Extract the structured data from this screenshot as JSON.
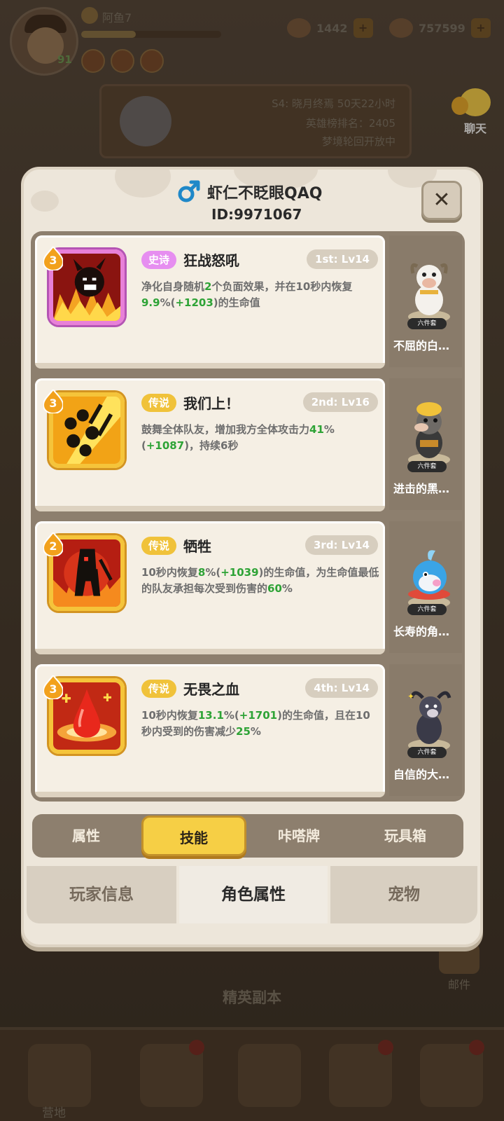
{
  "background": {
    "player_name": "阿鱼7",
    "player_level": "91",
    "resources": [
      {
        "icon": "gold-pile-icon",
        "value": "1442"
      },
      {
        "icon": "diamond-icon",
        "value": "757599"
      }
    ],
    "season_title": "S4: 晓月终焉 50天22小时",
    "season_rank": "英雄榜排名：2405",
    "season_note": "梦境轮回开放中",
    "chat_label": "聊天",
    "mail_label": "邮件",
    "dungeon_label": "精英副本",
    "camp_label": "营地"
  },
  "profile": {
    "gender_icon": "male-icon",
    "name": "虾仁不眨眼QAQ",
    "id": "ID:9971067"
  },
  "skills": [
    {
      "level": "3",
      "rarity": "史诗",
      "rarity_type": "epic",
      "name": "狂战怒吼",
      "rank": "1st: Lv14",
      "desc_parts": [
        {
          "t": "净化自身随机"
        },
        {
          "t": "2",
          "g": true
        },
        {
          "t": "个负面效果，并在10秒内恢复"
        },
        {
          "t": "9.9",
          "g": true
        },
        {
          "t": "%("
        },
        {
          "t": "+1203",
          "g": true
        },
        {
          "t": ")的生命值"
        }
      ],
      "icon": "berserk-roar-icon",
      "pet_name": "不屈的白…",
      "pet_tag": "六件套",
      "pet_icon": "white-goat-figure-icon"
    },
    {
      "level": "3",
      "rarity": "传说",
      "rarity_type": "legend",
      "name": "我们上！",
      "rank": "2nd: Lv16",
      "desc_parts": [
        {
          "t": "鼓舞全体队友，增加我方全体攻击力"
        },
        {
          "t": "41",
          "g": true
        },
        {
          "t": "%("
        },
        {
          "t": "+1087",
          "g": true
        },
        {
          "t": ")，持续6秒"
        }
      ],
      "icon": "charge-together-icon",
      "pet_name": "进击的黑…",
      "pet_tag": "六件套",
      "pet_icon": "black-cow-figure-icon"
    },
    {
      "level": "2",
      "rarity": "传说",
      "rarity_type": "legend",
      "name": "牺牲",
      "rank": "3rd: Lv14",
      "desc_parts": [
        {
          "t": "10秒内恢复"
        },
        {
          "t": "8",
          "g": true
        },
        {
          "t": "%("
        },
        {
          "t": "+1039",
          "g": true
        },
        {
          "t": ")的生命值，为生命值最低的队友承担每次受到伤害的"
        },
        {
          "t": "60",
          "g": true
        },
        {
          "t": "%"
        }
      ],
      "icon": "sacrifice-icon",
      "pet_name": "长寿的角…",
      "pet_tag": "六件套",
      "pet_icon": "blue-whale-figure-icon"
    },
    {
      "level": "3",
      "rarity": "传说",
      "rarity_type": "legend",
      "name": "无畏之血",
      "rank": "4th: Lv14",
      "desc_parts": [
        {
          "t": "10秒内恢复"
        },
        {
          "t": "13.1",
          "g": true
        },
        {
          "t": "%("
        },
        {
          "t": "+1701",
          "g": true
        },
        {
          "t": ")的生命值，且在10秒内受到的伤害减少"
        },
        {
          "t": "25",
          "g": true
        },
        {
          "t": "%"
        }
      ],
      "icon": "fearless-blood-icon",
      "pet_name": "自信的大…",
      "pet_tag": "六件套",
      "pet_icon": "dark-goat-figure-icon"
    }
  ],
  "subtabs": [
    "属性",
    "技能",
    "咔嗒牌",
    "玩具箱"
  ],
  "subtab_active": "技能",
  "maintabs": [
    "玩家信息",
    "角色属性",
    "宠物"
  ],
  "maintab_active": "角色属性",
  "colors": {
    "epic": "#e68ef0",
    "legend": "#f0c23a",
    "value_green": "#2ea336",
    "active_tab": "#f6cf45"
  }
}
